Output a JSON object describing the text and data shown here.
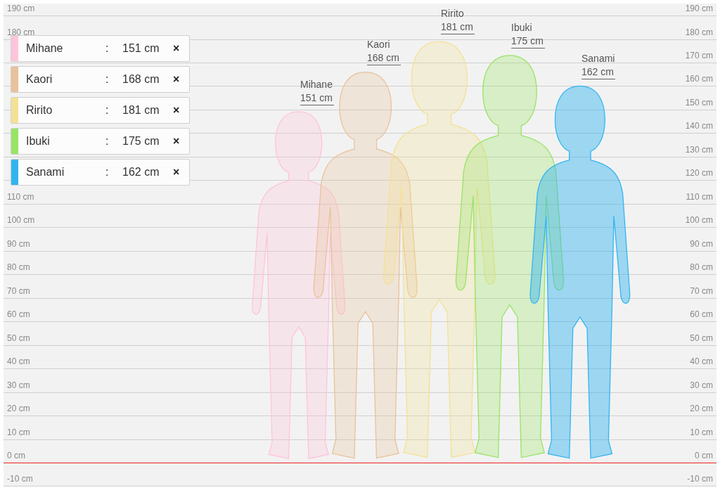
{
  "scale": {
    "left_ticks": [
      "190 cm",
      "180 cm",
      "110 cm",
      "100 cm",
      "90 cm",
      "80 cm",
      "70 cm",
      "60 cm",
      "50 cm",
      "40 cm",
      "30 cm",
      "20 cm",
      "10 cm",
      "0 cm",
      "-10 cm"
    ],
    "right_ticks": [
      "190 cm",
      "180 cm",
      "170 cm",
      "160 cm",
      "150 cm",
      "140 cm",
      "130 cm",
      "120 cm",
      "110 cm",
      "100 cm",
      "90 cm",
      "80 cm",
      "70 cm",
      "60 cm",
      "50 cm",
      "40 cm",
      "30 cm",
      "20 cm",
      "10 cm",
      "0 cm",
      "-10 cm"
    ]
  },
  "figures": [
    {
      "name": "Mihane",
      "height": "151 cm"
    },
    {
      "name": "Kaori",
      "height": "168 cm"
    },
    {
      "name": "Ririto",
      "height": "181 cm"
    },
    {
      "name": "Ibuki",
      "height": "175 cm"
    },
    {
      "name": "Sanami",
      "height": "162 cm"
    }
  ],
  "legend": [
    {
      "name": "Mihane",
      "separator": ":",
      "height": "151 cm",
      "remove": "×",
      "color": "#ffc4dc"
    },
    {
      "name": "Kaori",
      "separator": ":",
      "height": "168 cm",
      "remove": "×",
      "color": "#e8c29b"
    },
    {
      "name": "Ririto",
      "separator": ":",
      "height": "181 cm",
      "remove": "×",
      "color": "#f3e196"
    },
    {
      "name": "Ibuki",
      "separator": ":",
      "height": "175 cm",
      "remove": "×",
      "color": "#98e465"
    },
    {
      "name": "Sanami",
      "separator": ":",
      "height": "162 cm",
      "remove": "×",
      "color": "#34b4ef"
    }
  ]
}
